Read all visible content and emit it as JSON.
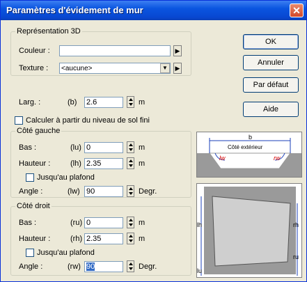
{
  "title": "Paramètres d'évidement de mur",
  "close_glyph": "✕",
  "rep3d": {
    "legend": "Représentation 3D",
    "couleur_label": "Couleur :",
    "couleur_value": "",
    "texture_label": "Texture :",
    "texture_value": "<aucune>"
  },
  "larg": {
    "label": "Larg. :",
    "var": "(b)",
    "value": "2.6",
    "unit": "m"
  },
  "calc_label": "Calculer à partir du niveau de sol fini",
  "left_side": {
    "legend": "Côté gauche",
    "bas_label": "Bas :",
    "bas_var": "(lu)",
    "bas_value": "0",
    "bas_unit": "m",
    "haut_label": "Hauteur :",
    "haut_var": "(lh)",
    "haut_value": "2.35",
    "haut_unit": "m",
    "ceiling_label": "Jusqu'au plafond",
    "angle_label": "Angle :",
    "angle_var": "(lw)",
    "angle_value": "90",
    "angle_unit": "Degr."
  },
  "right_side": {
    "legend": "Côté droit",
    "bas_label": "Bas :",
    "bas_var": "(ru)",
    "bas_value": "0",
    "bas_unit": "m",
    "haut_label": "Hauteur :",
    "haut_var": "(rh)",
    "haut_value": "2.35",
    "haut_unit": "m",
    "ceiling_label": "Jusqu'au plafond",
    "angle_label": "Angle :",
    "angle_var": "(rw)",
    "angle_value": "90",
    "angle_unit": "Degr."
  },
  "buttons": {
    "ok": "OK",
    "cancel": "Annuler",
    "default": "Par défaut",
    "help": "Aide"
  },
  "diagram_top": {
    "b": "b",
    "outside": "Côté extérieur",
    "lw": "lw",
    "rw": "rw"
  },
  "diagram_bottom": {
    "lh": "lh",
    "rh": "rh",
    "lu": "lu",
    "ru": "ru"
  },
  "colors": {
    "titlebar": "#0a55e0",
    "dialog_bg": "#ece9d8",
    "diagram_gray": "#9a9a9a",
    "diagram_red": "#d40000",
    "diagram_blue": "#1a3fb8"
  }
}
